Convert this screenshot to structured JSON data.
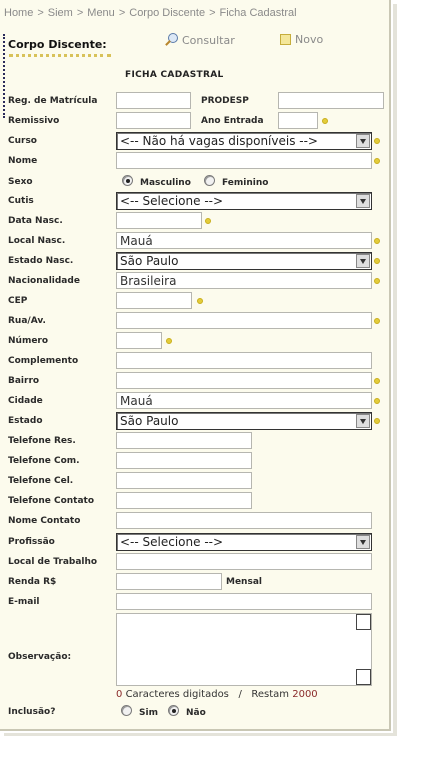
{
  "breadcrumb": [
    "Home",
    "Siem",
    "Menu",
    "Corpo Discente",
    "Ficha Cadastral"
  ],
  "breadcrumb_separator": ">",
  "section_title": "Corpo Discente:",
  "toolbar": {
    "consultar": "Consultar",
    "novo": "Novo"
  },
  "form_title": "FICHA CADASTRAL",
  "labels": {
    "reg_matricula": "Reg. de Matrícula",
    "prodesp": "PRODESP",
    "remissivo": "Remissivo",
    "ano_entrada": "Ano Entrada",
    "curso": "Curso",
    "nome": "Nome",
    "sexo": "Sexo",
    "cutis": "Cutis",
    "data_nasc": "Data Nasc.",
    "local_nasc": "Local Nasc.",
    "estado_nasc": "Estado Nasc.",
    "nacionalidade": "Nacionalidade",
    "cep": "CEP",
    "rua": "Rua/Av.",
    "numero": "Número",
    "complemento": "Complemento",
    "bairro": "Bairro",
    "cidade": "Cidade",
    "estado": "Estado",
    "tel_res": "Telefone Res.",
    "tel_com": "Telefone Com.",
    "tel_cel": "Telefone Cel.",
    "tel_contato": "Telefone Contato",
    "nome_contato": "Nome Contato",
    "profissao": "Profissão",
    "local_trabalho": "Local de Trabalho",
    "renda": "Renda R$",
    "mensal": "Mensal",
    "email": "E-mail",
    "observacao": "Observação:",
    "inclusao": "Inclusão?"
  },
  "values": {
    "reg_matricula": "",
    "prodesp": "",
    "remissivo": "",
    "ano_entrada": "",
    "curso": "<-- Não há vagas disponíveis -->",
    "nome": "",
    "cutis": "<-- Selecione -->",
    "data_nasc": "",
    "local_nasc": "Mauá",
    "estado_nasc": "São Paulo",
    "nacionalidade": "Brasileira",
    "cep": "",
    "rua": "",
    "numero": "",
    "complemento": "",
    "bairro": "",
    "cidade": "Mauá",
    "estado": "São Paulo",
    "tel_res": "",
    "tel_com": "",
    "tel_cel": "",
    "tel_contato": "",
    "nome_contato": "",
    "profissao": "<-- Selecione -->",
    "local_trabalho": "",
    "renda": "",
    "email": ""
  },
  "sexo_options": {
    "masculino": "Masculino",
    "feminino": "Feminino",
    "selected": "Masculino"
  },
  "inclusao_options": {
    "sim": "Sim",
    "nao": "Não",
    "selected": "Não"
  },
  "counter": {
    "typed": "0",
    "typed_label": "Caracteres digitados",
    "divider": "/",
    "remaining_label": "Restam",
    "remaining": "2000"
  },
  "colors": {
    "panel_bg": "#fcfbed",
    "required_dot": "#e3cc3a",
    "underline": "#d8c25a"
  },
  "icons": {
    "consultar": "magnifier-icon",
    "novo": "note-icon",
    "required": "required-dot-icon"
  }
}
